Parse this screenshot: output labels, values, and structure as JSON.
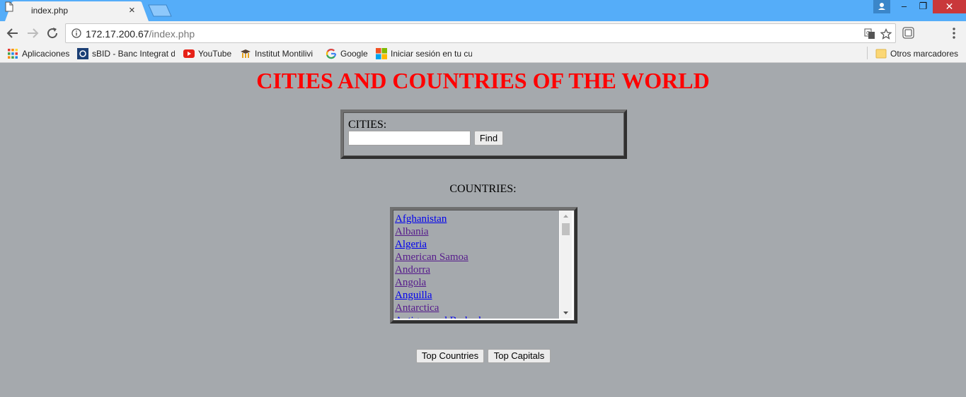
{
  "browser": {
    "tab_title": "index.php",
    "tab_close": "×",
    "url_host": "172.17.200.67",
    "url_path": "/index.php",
    "window_min": "–",
    "window_restore": "❐",
    "window_close": "✕"
  },
  "bookmarks": [
    {
      "label": "Aplicaciones",
      "icon": "apps-grid-icon"
    },
    {
      "label": "sBID - Banc Integrat d",
      "icon": "sbid-icon"
    },
    {
      "label": "YouTube",
      "icon": "youtube-icon"
    },
    {
      "label": "Institut Montilivi",
      "icon": "institut-icon"
    },
    {
      "label": "Google",
      "icon": "google-icon"
    },
    {
      "label": "Iniciar sesión en tu cu",
      "icon": "microsoft-icon"
    }
  ],
  "other_bookmarks": "Otros marcadores",
  "page": {
    "title": "CITIES AND COUNTRIES OF THE WORLD",
    "cities_label": "CITIES:",
    "city_value": "",
    "find_label": "Find",
    "countries_label": "COUNTRIES:",
    "countries": [
      {
        "name": "Afghanistan",
        "visited": false
      },
      {
        "name": "Albania",
        "visited": true
      },
      {
        "name": "Algeria",
        "visited": false
      },
      {
        "name": "American Samoa",
        "visited": true
      },
      {
        "name": "Andorra",
        "visited": true
      },
      {
        "name": "Angola",
        "visited": true
      },
      {
        "name": "Anguilla",
        "visited": false
      },
      {
        "name": "Antarctica",
        "visited": true
      },
      {
        "name": "Antigua and Barbuda",
        "visited": false
      }
    ],
    "top_countries_label": "Top Countries",
    "top_capitals_label": "Top Capitals"
  },
  "colors": {
    "title": "#ff0000",
    "link": "#0000ee",
    "visited_link": "#551a8b",
    "page_bg": "#a5a9ad",
    "titlebar": "#55adf9"
  }
}
